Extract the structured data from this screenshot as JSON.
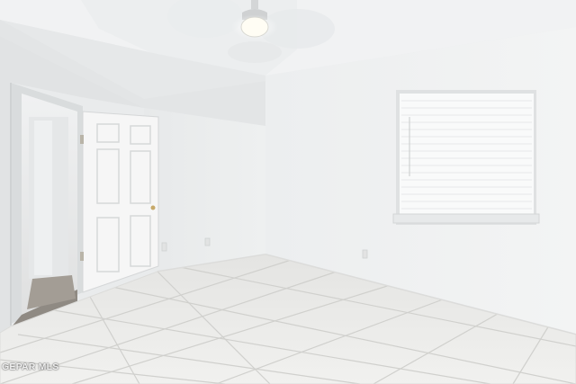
{
  "photo": {
    "watermark": "GEPAR MLS",
    "scene_objects": [
      "ceiling-fan",
      "door",
      "window-blind",
      "tile-floor",
      "hallway-doorway"
    ],
    "colors": {
      "wall": "#eff0f1",
      "ceiling": "#f3f4f5",
      "floor": "#ececea",
      "grout": "#d2d2cf",
      "door": "#f7f7f7"
    }
  }
}
